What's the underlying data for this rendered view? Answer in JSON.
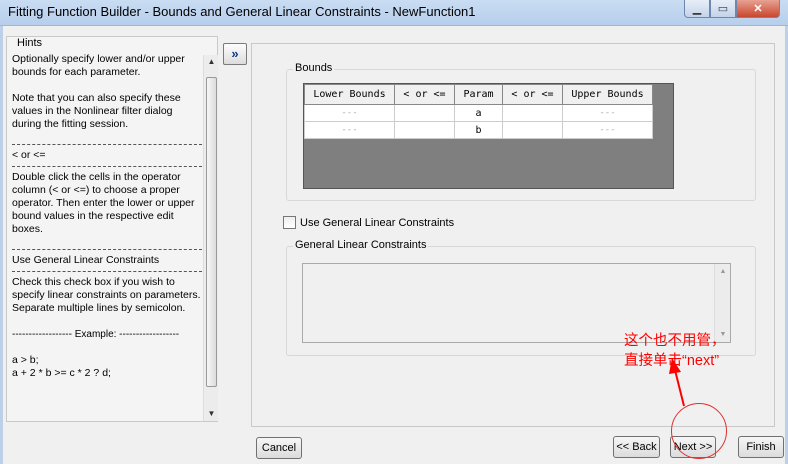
{
  "window": {
    "title": "Fitting Function Builder - Bounds and General Linear Constraints - NewFunction1",
    "min_glyph": "▁",
    "max_glyph": "▭",
    "close_glyph": "✕"
  },
  "hints": {
    "legend": "Hints",
    "paragraphs": [
      "Optionally specify lower and/or upper bounds for each parameter.",
      "Note that you can also specify these values in the Nonlinear filter dialog during the fitting session."
    ],
    "section1_title": "< or <=",
    "section1_text": "Double click the cells in the operator column (< or <=) to choose a proper operator. Then enter the lower or upper bound values in the respective edit boxes.",
    "section2_title": "Use General Linear Constraints",
    "section2_text": "Check this check box if you wish to specify linear constraints on parameters. Separate multiple lines by semicolon.",
    "example_label": "------------------ Example: ------------------",
    "example_lines": [
      "a > b;",
      "a + 2 * b >= c * 2 ? d;"
    ]
  },
  "expand_button": "»",
  "bounds": {
    "label": "Bounds",
    "columns": [
      "Lower Bounds",
      "< or <=",
      "Param",
      "< or <=",
      "Upper Bounds"
    ],
    "rows": [
      [
        "---",
        "",
        "a",
        "",
        "---"
      ],
      [
        "---",
        "",
        "b",
        "",
        "---"
      ]
    ]
  },
  "use_glc_label": "Use General Linear Constraints",
  "glc_group_label": "General Linear Constraints",
  "buttons": {
    "cancel": "Cancel",
    "back": "<< Back",
    "next": "Next >>",
    "finish": "Finish"
  },
  "annotation": {
    "line1": "这个也不用管，",
    "line2": "直接单击“next”"
  }
}
